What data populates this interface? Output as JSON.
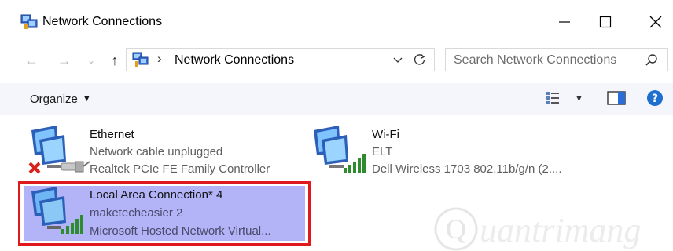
{
  "window": {
    "title": "Network Connections"
  },
  "address_bar": {
    "path": "Network Connections"
  },
  "search": {
    "placeholder": "Search Network Connections"
  },
  "toolbar": {
    "organize_label": "Organize"
  },
  "connections": [
    {
      "name": "Ethernet",
      "status": "Network cable unplugged",
      "device": "Realtek PCIe FE Family Controller",
      "icon": "ethernet-disconnected-icon",
      "selected": false
    },
    {
      "name": "Wi-Fi",
      "status": "ELT",
      "device": "Dell Wireless 1703 802.11b/g/n (2....",
      "icon": "wifi-signal-icon",
      "selected": false
    },
    {
      "name": "Local Area Connection* 4",
      "status": "maketecheasier  2",
      "device": "Microsoft Hosted Network Virtual...",
      "icon": "wifi-signal-icon",
      "selected": true
    }
  ],
  "watermark": {
    "text": "Quantrimang"
  },
  "colors": {
    "selection_fill": "#b3b3f7",
    "highlight_border": "#e0191e",
    "signal_green": "#2e8b2e",
    "help_blue": "#1f6fd1"
  }
}
